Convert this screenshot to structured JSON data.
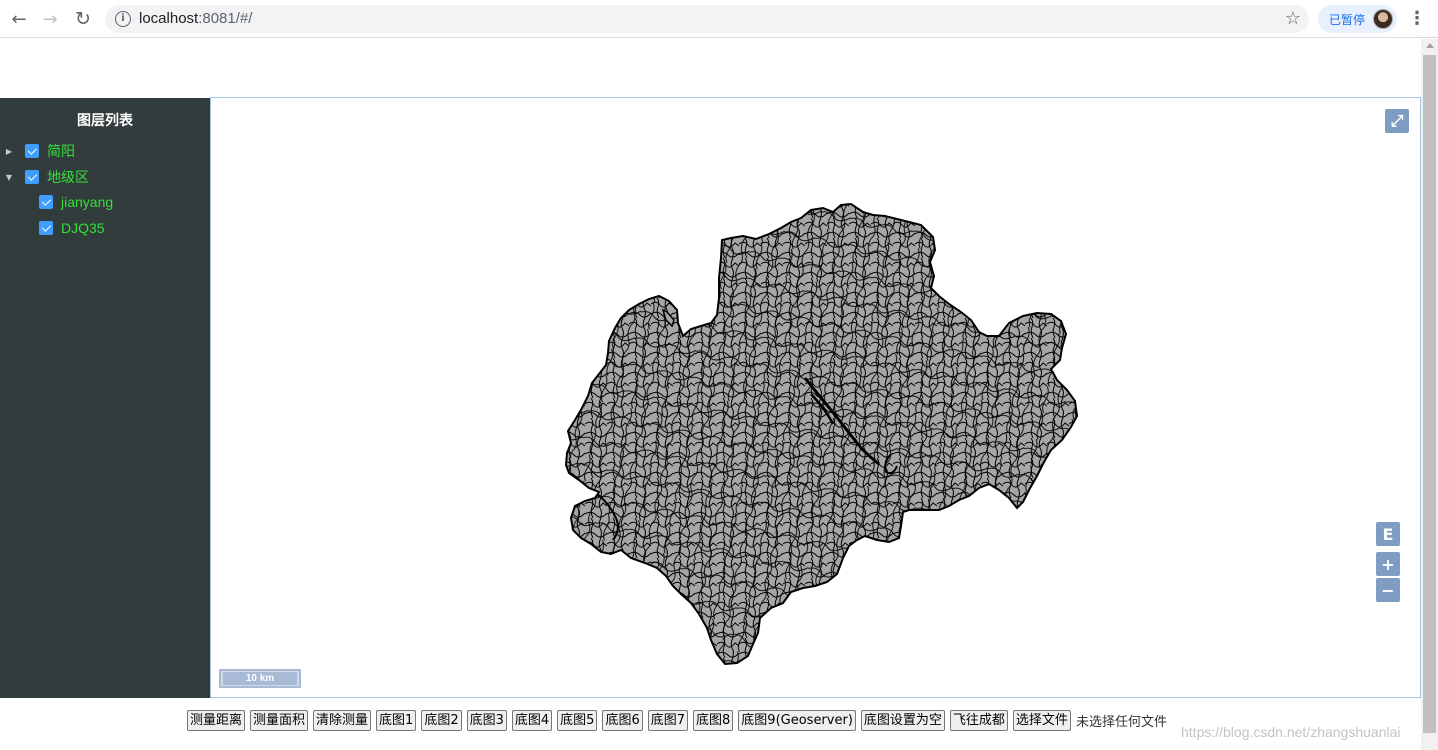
{
  "browser": {
    "url_host": "localhost",
    "url_rest": ":8081/#/",
    "profile_label": "已暂停",
    "icons": [
      "back-arrow-icon",
      "forward-arrow-icon",
      "reload-icon",
      "info-icon",
      "star-icon",
      "kebab-menu-icon"
    ]
  },
  "sidebar": {
    "title": "图层列表",
    "items": [
      {
        "label": "简阳",
        "expanded": false,
        "checked": true
      },
      {
        "label": "地级区",
        "expanded": true,
        "checked": true
      },
      {
        "label": "jianyang",
        "checked": true
      },
      {
        "label": "DJQ35",
        "checked": true
      }
    ],
    "label_color": "#33e03a",
    "checkbox_color": "#409eff",
    "background": "#323c3c"
  },
  "map": {
    "fullscreen_icon": "⤢",
    "extent_label": "E",
    "zoom_in": "+",
    "zoom_out": "−",
    "scale_label": "10 km",
    "fill_color": "#a6a6a6",
    "stroke_color": "#000000"
  },
  "toolbar": {
    "buttons": [
      "测量距离",
      "测量面积",
      "清除测量",
      "底图1",
      "底图2",
      "底图3",
      "底图4",
      "底图5",
      "底图6",
      "底图7",
      "底图8",
      "底图9(Geoserver)",
      "底图设置为空",
      "飞往成都",
      "选择文件"
    ],
    "file_status": "未选择任何文件"
  },
  "watermark": "https://blog.csdn.net/zhangshuanlai"
}
